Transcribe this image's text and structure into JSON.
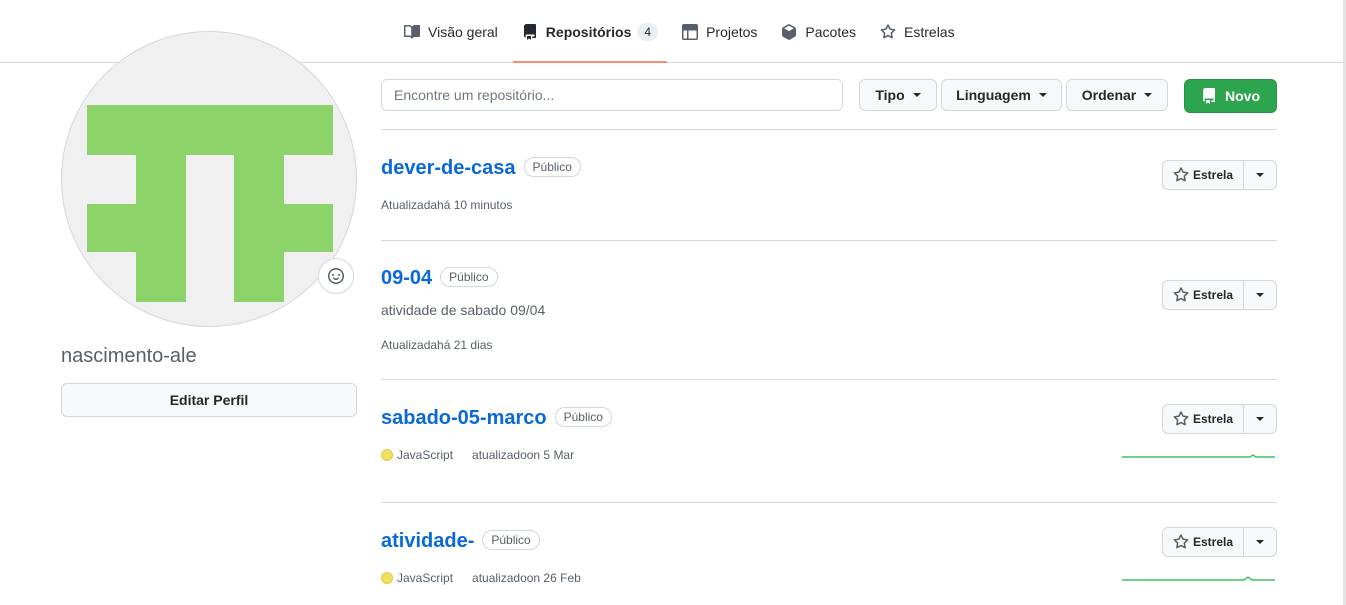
{
  "tabs": [
    {
      "label": "Visão geral",
      "icon": "book-icon"
    },
    {
      "label": "Repositórios",
      "icon": "repo-icon",
      "count": "4"
    },
    {
      "label": "Projetos",
      "icon": "table-icon"
    },
    {
      "label": "Pacotes",
      "icon": "package-icon"
    },
    {
      "label": "Estrelas",
      "icon": "star-icon"
    }
  ],
  "profile": {
    "username": "nascimento-ale",
    "edit_label": "Editar Perfil",
    "avatar_color": "#8cd369"
  },
  "filters": {
    "search_placeholder": "Encontre um repositório...",
    "type_label": "Tipo",
    "language_label": "Linguagem",
    "sort_label": "Ordenar",
    "new_label": "Novo"
  },
  "colors": {
    "accent_link": "#0969da",
    "primary_button": "#2da44e",
    "tab_underline": "#fd8c73",
    "javascript": "#f1e05a"
  },
  "repos": [
    {
      "name": "dever-de-casa",
      "visibility": "Público",
      "description": "",
      "language": "",
      "updated_label": "Atualizada",
      "updated": "há 10 minutos",
      "star_label": "Estrela"
    },
    {
      "name": "09-04",
      "visibility": "Público",
      "description": "atividade de sabado 09/04",
      "language": "",
      "updated_label": "Atualizada",
      "updated": "há 21 dias",
      "star_label": "Estrela"
    },
    {
      "name": "sabado-05-marco",
      "visibility": "Público",
      "description": "",
      "language": "JavaScript",
      "updated_label": "atualizado",
      "updated": "on 5 Mar",
      "star_label": "Estrela"
    },
    {
      "name": "atividade-",
      "visibility": "Público",
      "description": "",
      "language": "JavaScript",
      "updated_label": "atualizado",
      "updated": "on 26 Feb",
      "star_label": "Estrela"
    }
  ]
}
